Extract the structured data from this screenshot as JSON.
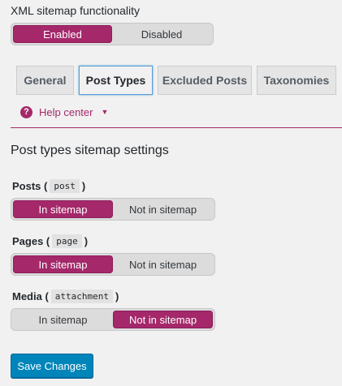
{
  "feature": {
    "title": "XML sitemap functionality",
    "enabled_label": "Enabled",
    "disabled_label": "Disabled",
    "selected": "Enabled"
  },
  "tabs": [
    {
      "label": "General"
    },
    {
      "label": "Post Types",
      "active": true
    },
    {
      "label": "Excluded Posts"
    },
    {
      "label": "Taxonomies"
    }
  ],
  "help": {
    "label": "Help center"
  },
  "section": {
    "heading": "Post types sitemap settings"
  },
  "post_types": [
    {
      "label": "Posts (",
      "code": "post",
      "close": ")",
      "on_label": "In sitemap",
      "off_label": "Not in sitemap",
      "selected": "In sitemap"
    },
    {
      "label": "Pages (",
      "code": "page",
      "close": ")",
      "on_label": "In sitemap",
      "off_label": "Not in sitemap",
      "selected": "In sitemap"
    },
    {
      "label": "Media (",
      "code": "attachment",
      "close": ")",
      "on_label": "In sitemap",
      "off_label": "Not in sitemap",
      "selected": "Not in sitemap"
    }
  ],
  "save_label": "Save Changes",
  "colors": {
    "accent": "#a4286a",
    "primary_button": "#0085ba"
  }
}
